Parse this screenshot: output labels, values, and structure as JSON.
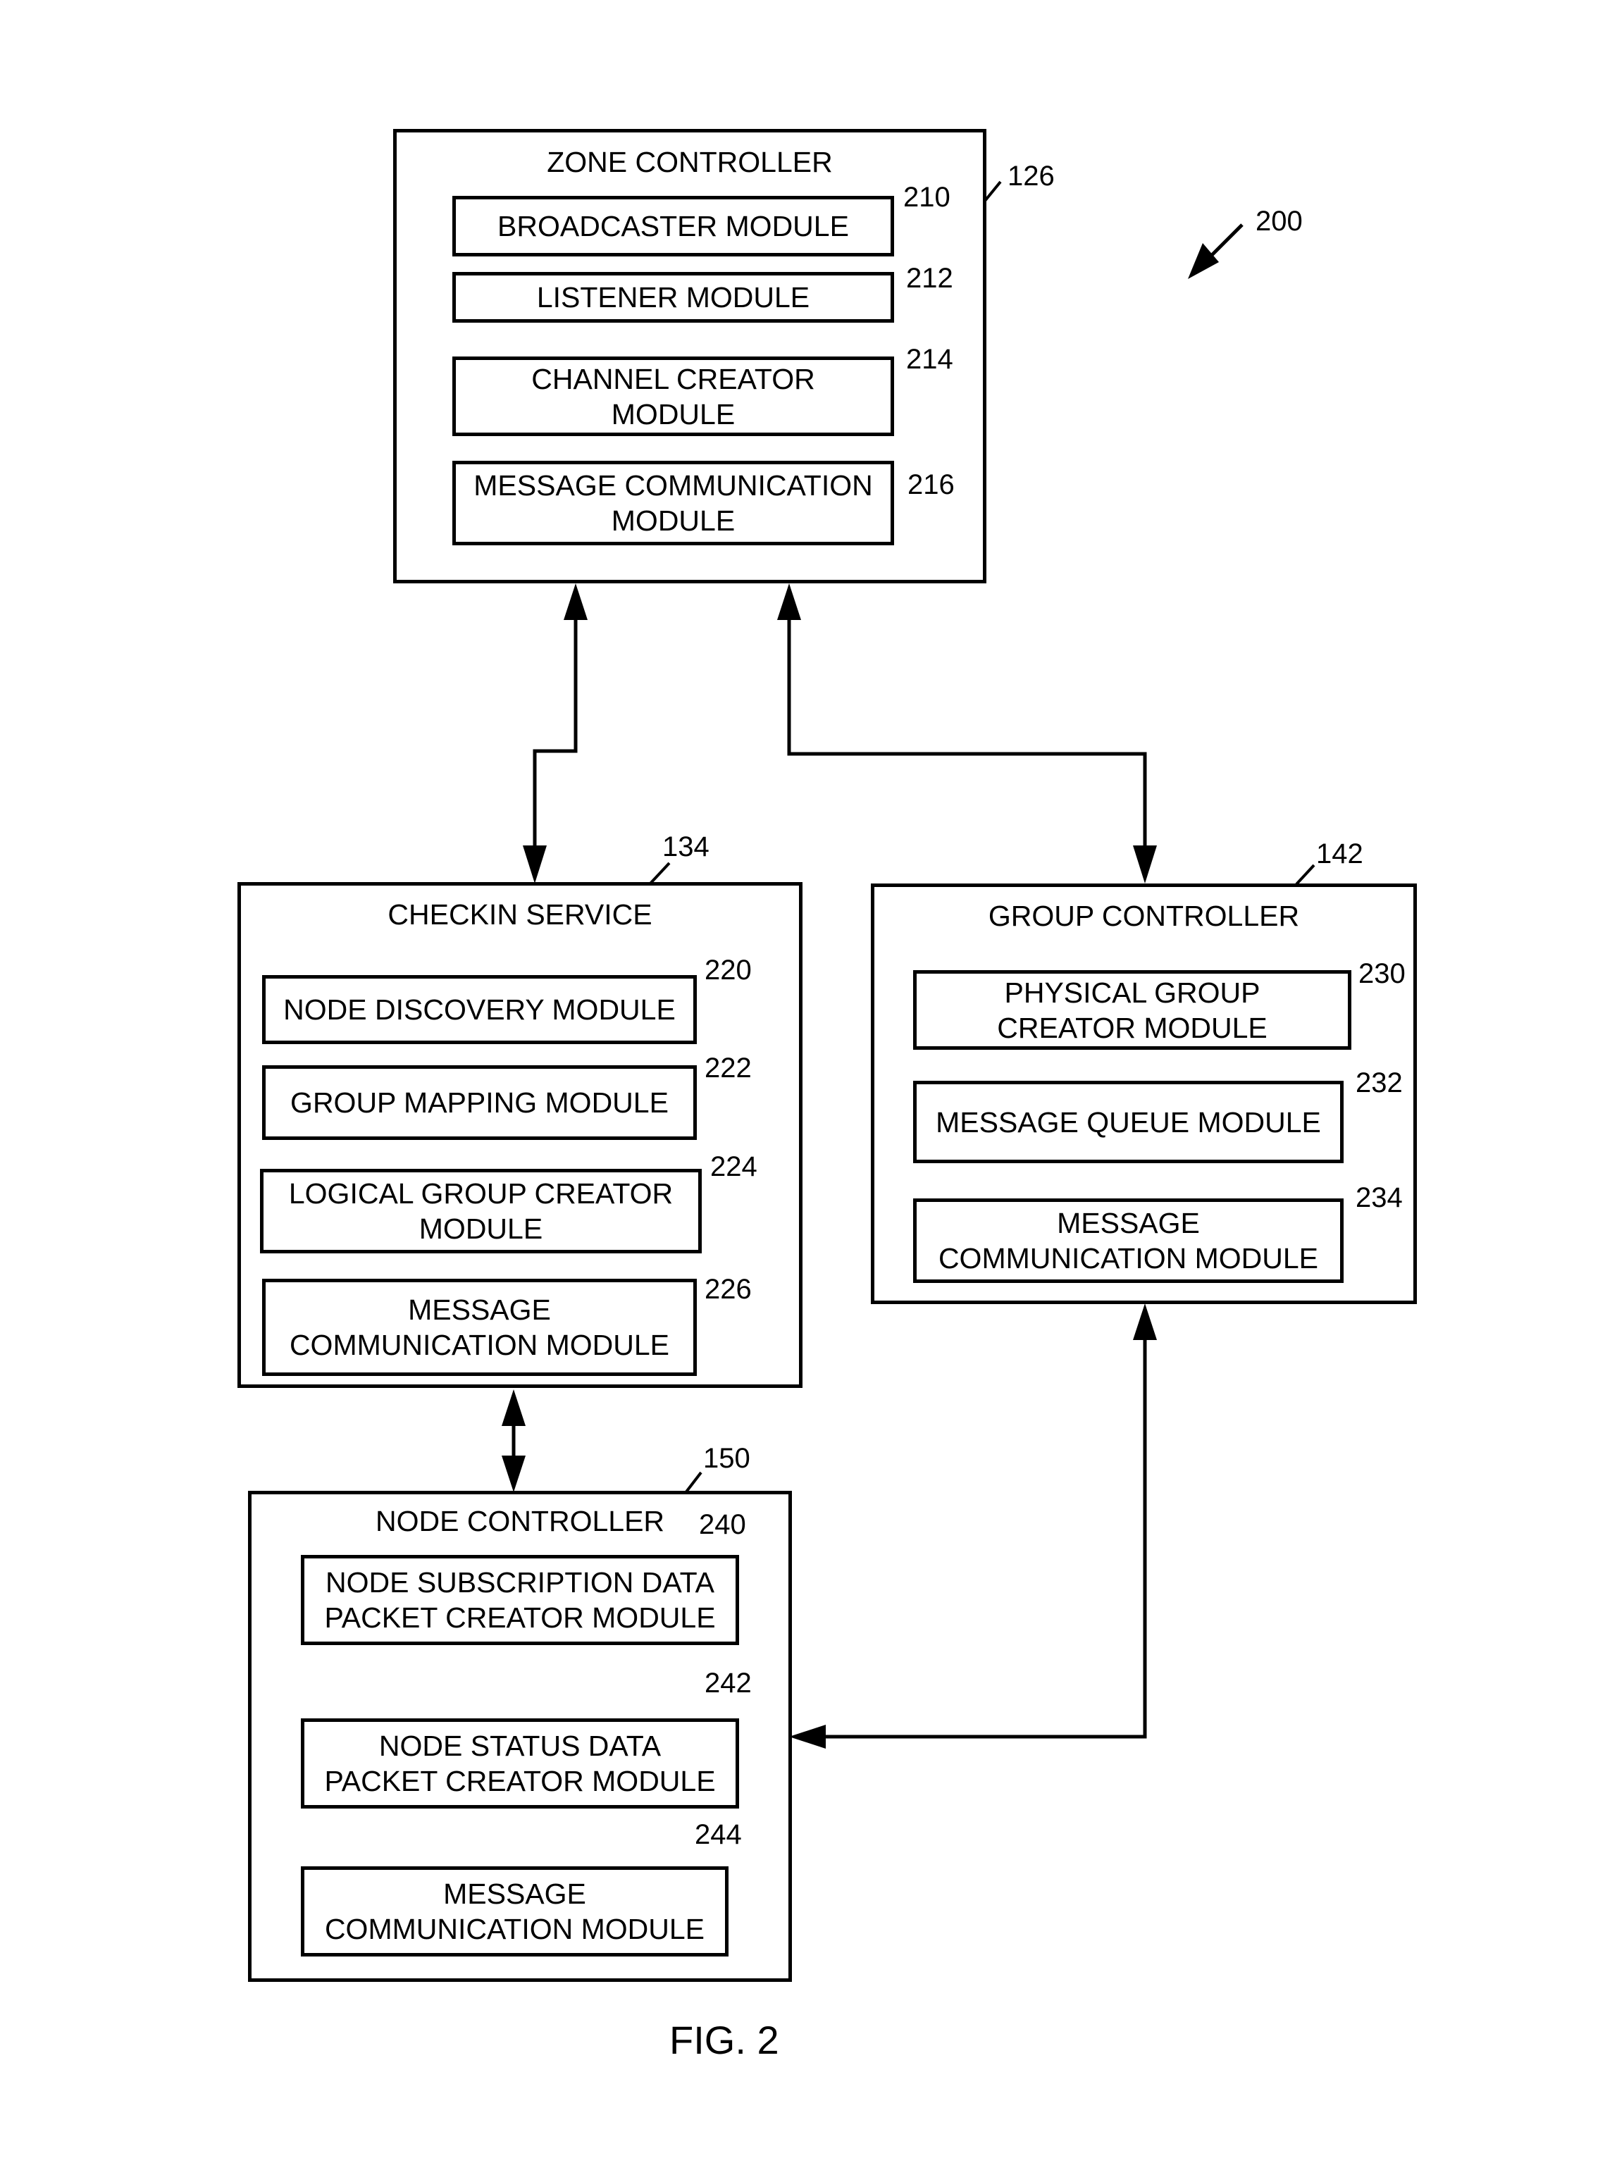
{
  "figure_label": "FIG. 2",
  "diagram_ref": "200",
  "zone_controller": {
    "title": "ZONE CONTROLLER",
    "ref": "126",
    "modules": [
      {
        "label": "BROADCASTER MODULE",
        "ref": "210"
      },
      {
        "label": "LISTENER MODULE",
        "ref": "212"
      },
      {
        "label": "CHANNEL CREATOR\nMODULE",
        "ref": "214"
      },
      {
        "label": "MESSAGE COMMUNICATION\nMODULE",
        "ref": "216"
      }
    ]
  },
  "checkin_service": {
    "title": "CHECKIN SERVICE",
    "ref": "134",
    "modules": [
      {
        "label": "NODE DISCOVERY MODULE",
        "ref": "220"
      },
      {
        "label": "GROUP MAPPING MODULE",
        "ref": "222"
      },
      {
        "label": "LOGICAL GROUP CREATOR\nMODULE",
        "ref": "224"
      },
      {
        "label": "MESSAGE\nCOMMUNICATION MODULE",
        "ref": "226"
      }
    ]
  },
  "group_controller": {
    "title": "GROUP CONTROLLER",
    "ref": "142",
    "modules": [
      {
        "label": "PHYSICAL GROUP\nCREATOR MODULE",
        "ref": "230"
      },
      {
        "label": "MESSAGE QUEUE MODULE",
        "ref": "232"
      },
      {
        "label": "MESSAGE\nCOMMUNICATION MODULE",
        "ref": "234"
      }
    ]
  },
  "node_controller": {
    "title": "NODE CONTROLLER",
    "ref": "150",
    "modules": [
      {
        "label": "NODE SUBSCRIPTION DATA\nPACKET CREATOR MODULE",
        "ref": "240"
      },
      {
        "label": "NODE STATUS DATA\nPACKET CREATOR MODULE",
        "ref": "242"
      },
      {
        "label": "MESSAGE\nCOMMUNICATION MODULE",
        "ref": "244"
      }
    ]
  },
  "connections": [
    {
      "from": "zone_controller",
      "to": "checkin_service",
      "direction": "bidirectional"
    },
    {
      "from": "zone_controller",
      "to": "group_controller",
      "direction": "bidirectional"
    },
    {
      "from": "checkin_service",
      "to": "node_controller",
      "direction": "bidirectional"
    },
    {
      "from": "group_controller",
      "to": "node_controller",
      "direction": "bidirectional"
    }
  ]
}
